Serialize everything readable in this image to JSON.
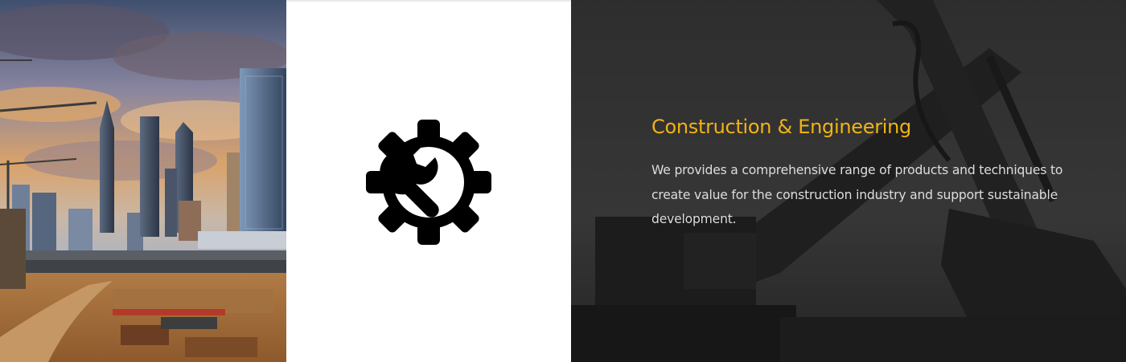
{
  "photo": {
    "description_icon": "city-construction-photo"
  },
  "service": {
    "icon": "gear-wrench-icon",
    "title": "Construction & Engineering",
    "description": "We provides a comprehensive range of products and techniques to create value for the construction industry and support sustainable development."
  },
  "colors": {
    "accent": "#f1b315",
    "text_light": "#dddddd",
    "panel_dark": "#2b2b2b",
    "icon": "#000000"
  },
  "background": {
    "icon": "excavator-photo"
  }
}
